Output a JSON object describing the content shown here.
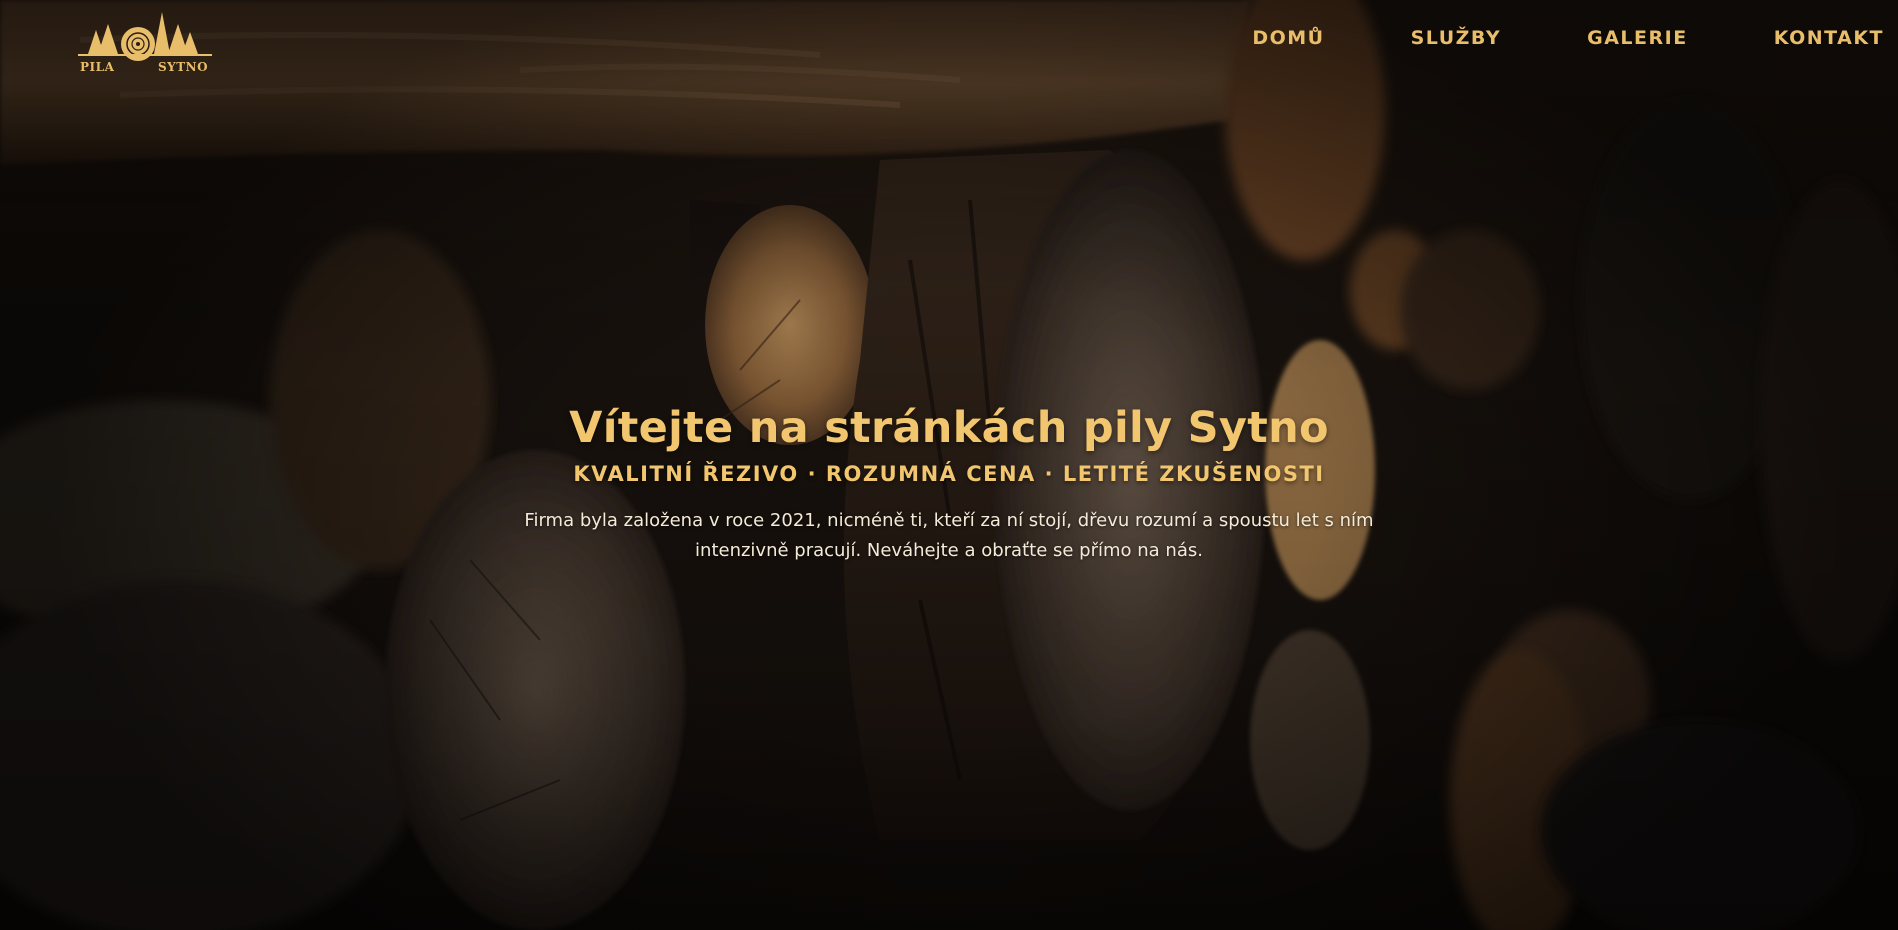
{
  "brand": {
    "logo_word_left": "PILA",
    "logo_word_right": "SYTNO",
    "accent_color": "#e9be6b"
  },
  "nav": {
    "items": [
      {
        "label": "DOMŮ"
      },
      {
        "label": "SLUŽBY"
      },
      {
        "label": "GALERIE"
      },
      {
        "label": "KONTAKT"
      }
    ]
  },
  "hero": {
    "title": "Vítejte na stránkách pily Sytno",
    "subtitle": "KVALITNÍ ŘEZIVO · ROZUMNÁ CENA · LETITÉ ZKUŠENOSTI",
    "description": "Firma byla založena v roce 2021, nicméně ti, kteří za ní stojí, dřevu rozumí a spoustu let s ním intenzivně pracují. Neváhejte a obraťte se přímo na nás.",
    "background": "stacked-firewood-logs-photo"
  }
}
